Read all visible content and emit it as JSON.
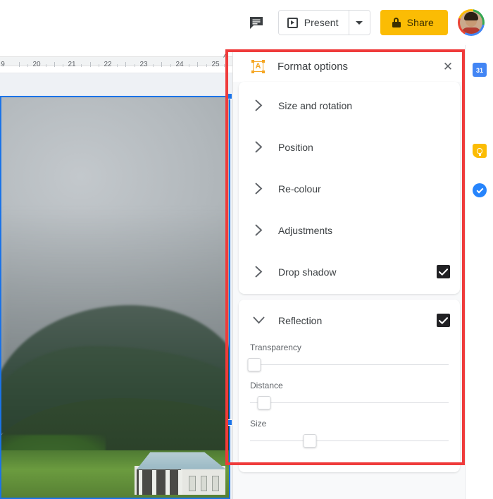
{
  "toolbar": {
    "comment_icon": "comment-icon",
    "present_label": "Present",
    "present_caret_icon": "chevron-down-icon",
    "share_label": "Share",
    "share_lock_icon": "lock-icon",
    "share_bg_color": "#fbbc04",
    "avatar_name": "account-avatar"
  },
  "ruler": {
    "unit_marks": [
      "9",
      "20",
      "21",
      "22",
      "23",
      "24",
      "25"
    ],
    "collapse_caret_icon": "chevron-up-icon"
  },
  "canvas": {
    "image_alt": "photo of overcast sky over forested mountain ridge with white house",
    "selection_color": "#1a73e8"
  },
  "panel": {
    "icon": "image-format-icon",
    "title": "Format options",
    "close_icon": "close-icon",
    "sections": [
      {
        "label": "Size and rotation",
        "chevron": "chevron-right-icon",
        "expanded": false,
        "has_checkbox": false
      },
      {
        "label": "Position",
        "chevron": "chevron-right-icon",
        "expanded": false,
        "has_checkbox": false
      },
      {
        "label": "Re-colour",
        "chevron": "chevron-right-icon",
        "expanded": false,
        "has_checkbox": false
      },
      {
        "label": "Adjustments",
        "chevron": "chevron-right-icon",
        "expanded": false,
        "has_checkbox": false
      },
      {
        "label": "Drop shadow",
        "chevron": "chevron-right-icon",
        "expanded": false,
        "has_checkbox": true,
        "checked": true
      }
    ],
    "reflection": {
      "label": "Reflection",
      "chevron": "chevron-down-icon",
      "expanded": true,
      "checked": true,
      "sliders": [
        {
          "label": "Transparency",
          "value_pct": 2
        },
        {
          "label": "Distance",
          "value_pct": 7
        },
        {
          "label": "Size",
          "value_pct": 30
        }
      ]
    },
    "checkbox_color": "#212124"
  },
  "side_rail": {
    "items": [
      {
        "name": "calendar",
        "badge": "31",
        "color": "#4285f4"
      },
      {
        "name": "keep",
        "badge": "",
        "color": "#fbbc04"
      },
      {
        "name": "tasks",
        "badge": "",
        "color": "#2684fc"
      }
    ]
  },
  "annotation": {
    "color": "#ef3b3b",
    "name": "highlight-rectangle"
  }
}
